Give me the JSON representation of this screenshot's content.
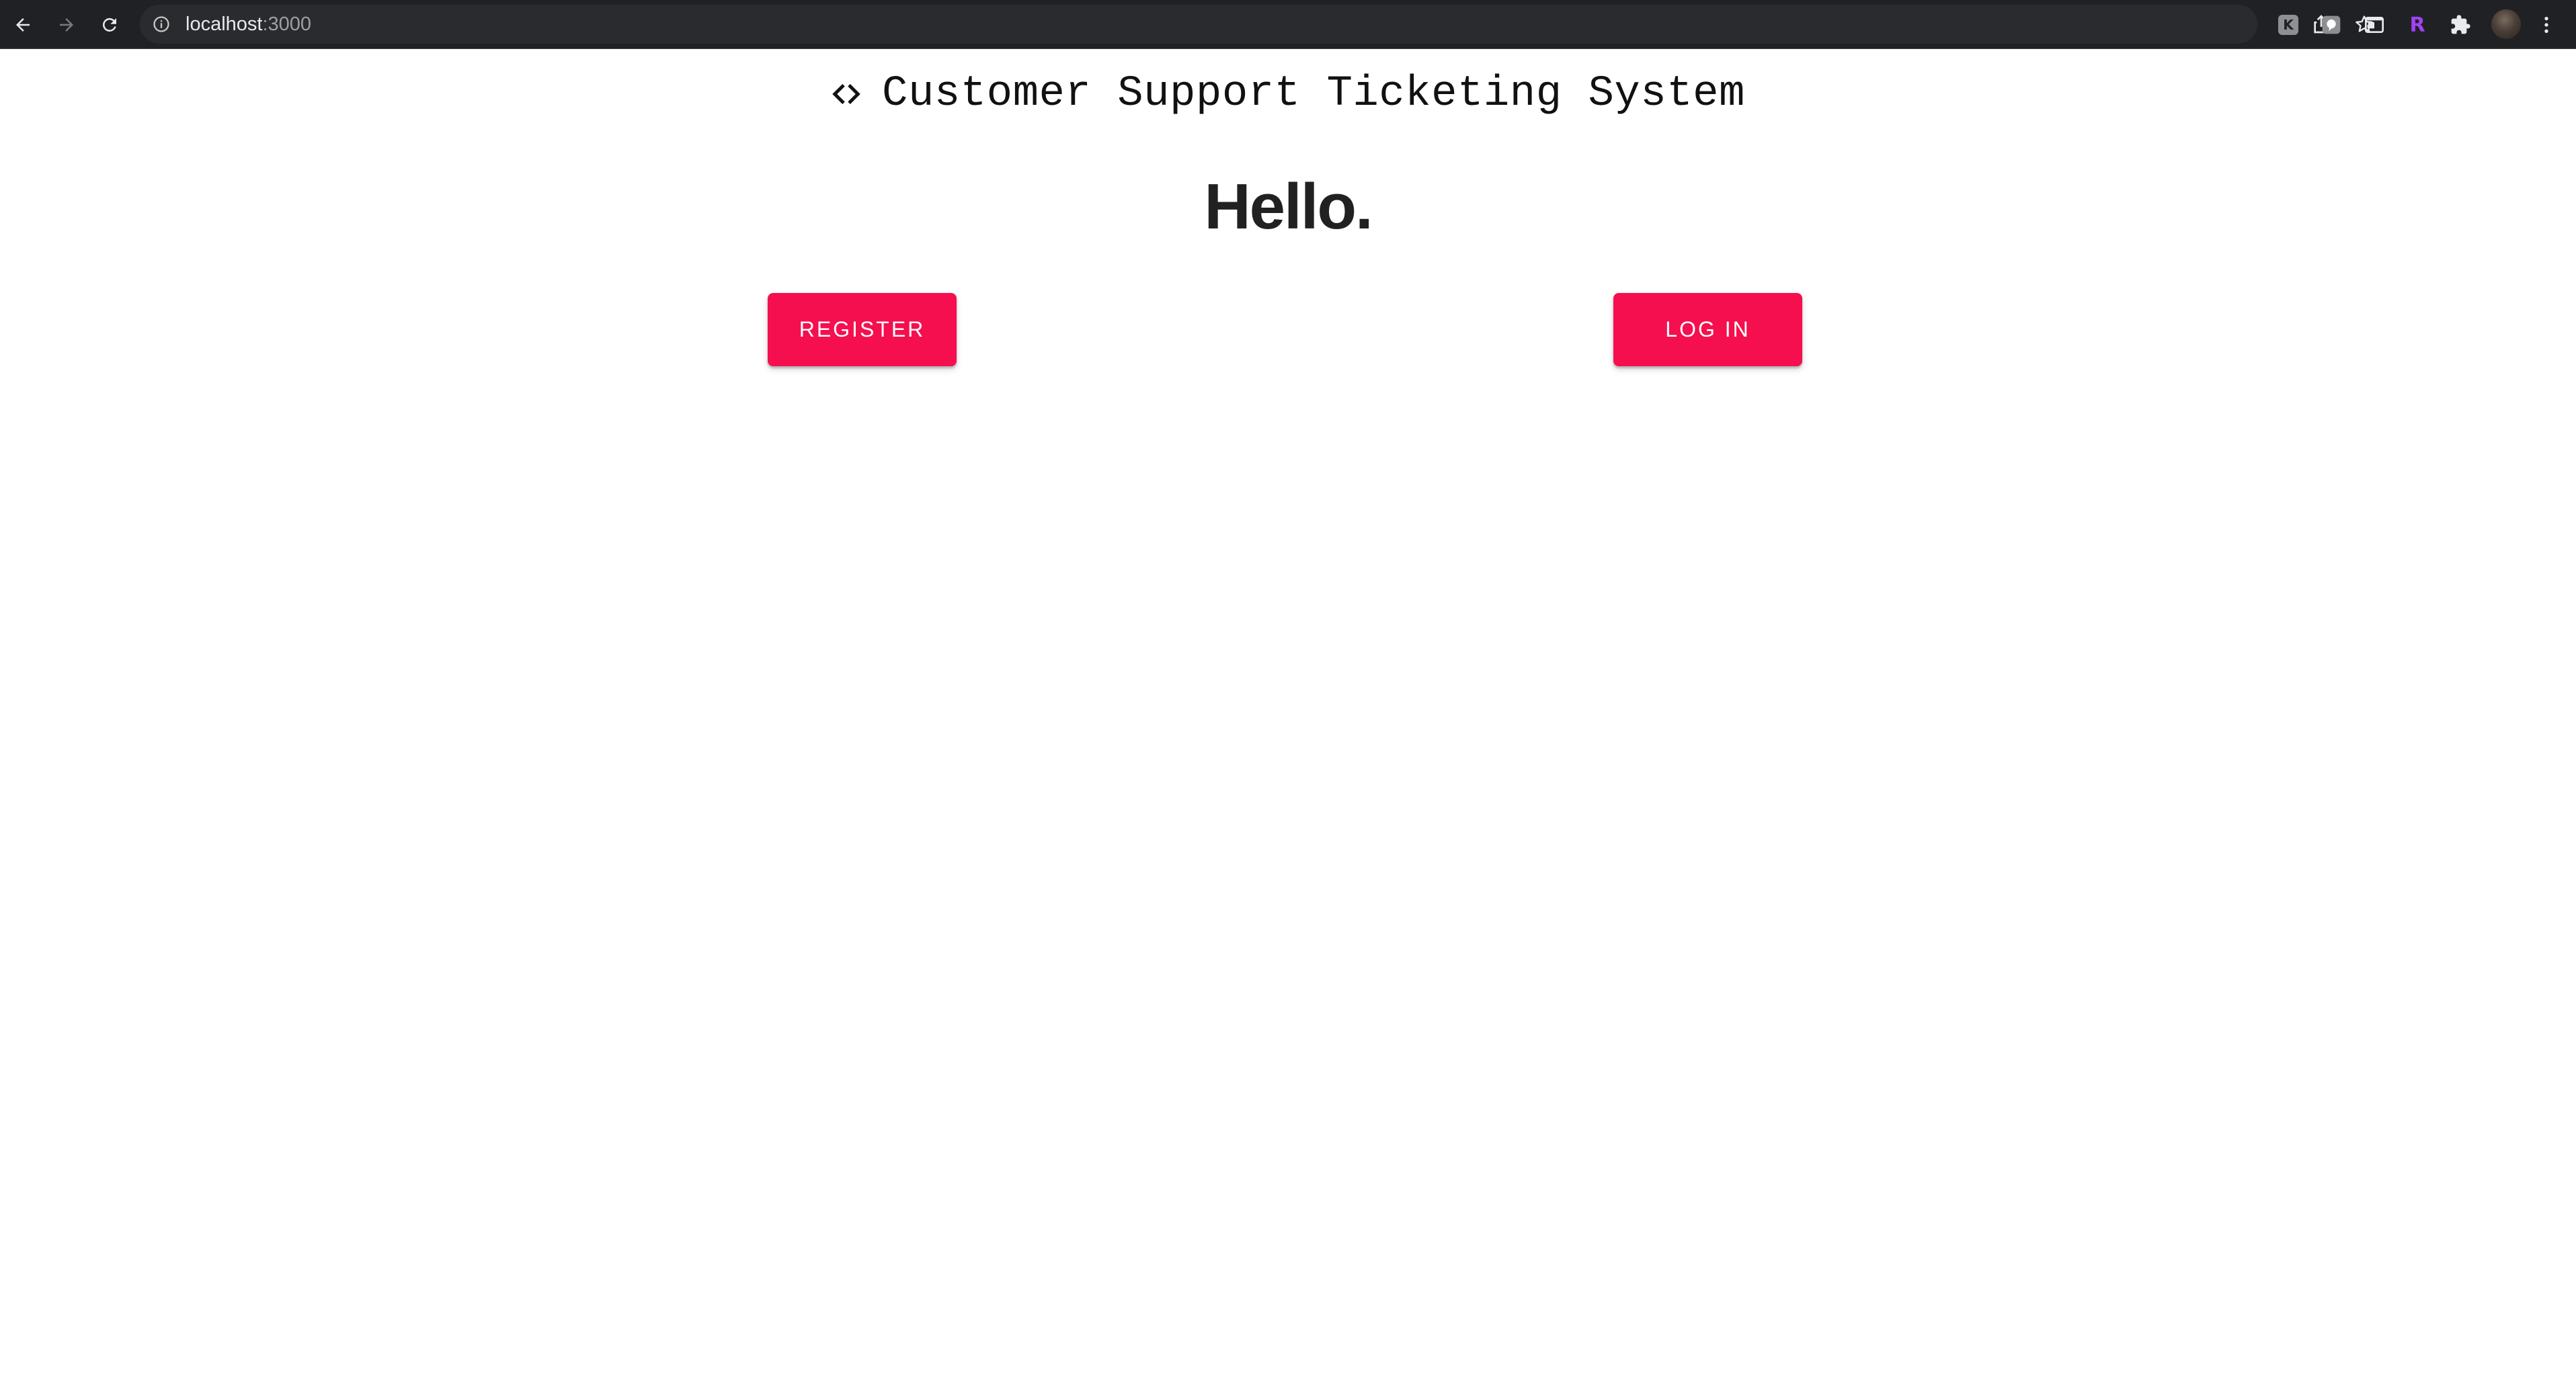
{
  "browser": {
    "url_host": "localhost",
    "url_port": ":3000",
    "icons": {
      "back": "arrow-left-icon",
      "forward": "arrow-right-icon",
      "reload": "reload-icon",
      "site_info": "info-circle-icon",
      "share": "share-icon",
      "bookmark": "star-icon",
      "extension_1_letter": "K",
      "extension_4_letter": "R",
      "extensions": "puzzle-icon",
      "menu": "kebab-menu-icon"
    }
  },
  "header": {
    "icon": "code-brackets-icon",
    "title": "Customer Support Ticketing System"
  },
  "main": {
    "greeting": "Hello.",
    "register_label": "REGISTER",
    "login_label": "LOG IN"
  },
  "colors": {
    "accent": "#f50f4f",
    "chrome_bg": "#202124",
    "text": "#212121"
  }
}
